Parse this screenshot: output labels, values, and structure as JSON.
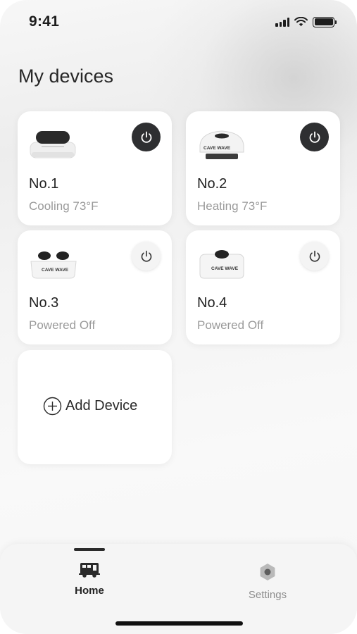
{
  "status_bar": {
    "time": "9:41"
  },
  "page": {
    "title": "My devices"
  },
  "devices": [
    {
      "name": "No.1",
      "status": "Cooling 73°F",
      "power": "on"
    },
    {
      "name": "No.2",
      "status": "Heating 73°F",
      "power": "on",
      "brand_text": "CAVE WAVE"
    },
    {
      "name": "No.3",
      "status": "Powered Off",
      "power": "off",
      "brand_text": "CAVE WAVE"
    },
    {
      "name": "No.4",
      "status": "Powered Off",
      "power": "off",
      "brand_text": "CAVE WAVE"
    }
  ],
  "add_device": {
    "label": "Add Device"
  },
  "tab_bar": {
    "tabs": [
      {
        "label": "Home",
        "icon": "rv-camper-icon",
        "active": true
      },
      {
        "label": "Settings",
        "icon": "gear-icon",
        "active": false
      }
    ]
  },
  "colors": {
    "power_on_bg": "#2e2f31",
    "power_off_bg": "#f4f4f4",
    "muted_text": "#9a9a9a"
  }
}
